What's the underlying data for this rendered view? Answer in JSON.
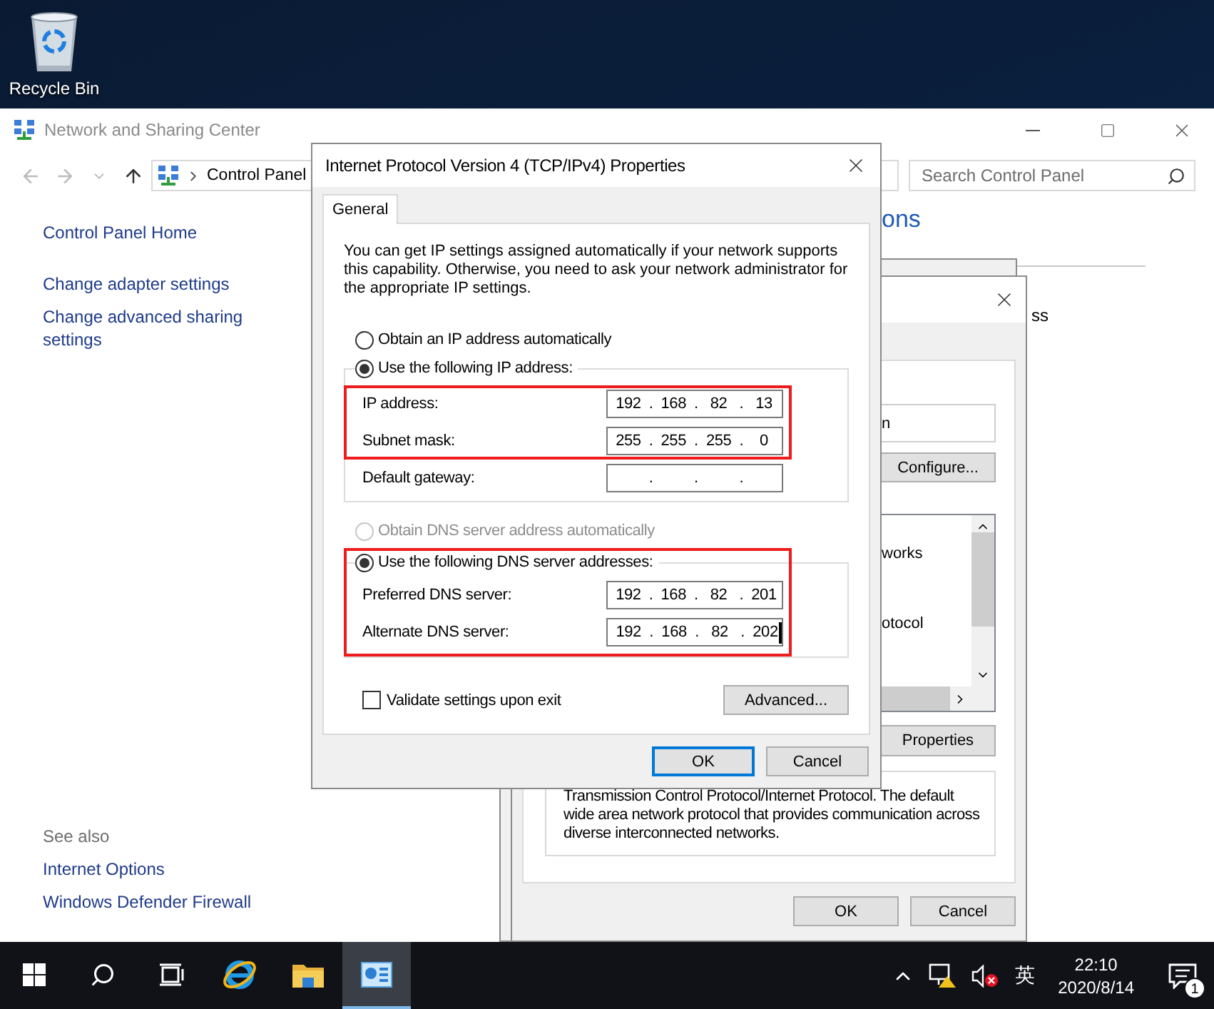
{
  "desktop": {
    "icons": [
      {
        "label": "Recycle Bin"
      }
    ]
  },
  "explorer": {
    "title": "Network and Sharing Center",
    "active": false,
    "nav": {
      "back": {
        "disabled": true
      },
      "forward": {
        "disabled": true
      },
      "up": {
        "disabled": false
      }
    },
    "address": "Control Panel",
    "search": {
      "placeholder": "Search Control Panel"
    },
    "sidebar": {
      "links": [
        "Control Panel Home",
        "Change adapter settings",
        "Change advanced sharing settings"
      ],
      "see_also": {
        "heading": "See also",
        "links": [
          "Internet Options",
          "Windows Defender Firewall"
        ]
      }
    },
    "main": {
      "heading": "ons",
      "fragment": "ss"
    }
  },
  "adapter_dialog": {
    "field_text": "n",
    "configure": "Configure...",
    "list_items": [
      "works",
      "otocol"
    ],
    "properties": "Properties",
    "description": "Transmission Control Protocol/Internet Protocol. The default wide area network protocol that provides communication across diverse interconnected networks.",
    "buttons": [
      {
        "label": "OK",
        "default": false
      },
      {
        "label": "Cancel",
        "default": false
      }
    ]
  },
  "ipv4_dialog": {
    "title": "Internet Protocol Version 4 (TCP/IPv4) Properties",
    "tabs": [
      {
        "label": "General",
        "selected": true
      }
    ],
    "intro": "You can get IP settings assigned automatically if your network supports this capability. Otherwise, you need to ask your network administrator for the appropriate IP settings.",
    "ip_auto": {
      "label": "Obtain an IP address automatically",
      "selected": false,
      "disabled": false
    },
    "ip_group": {
      "label": "Use the following IP address:",
      "selected": true,
      "highlighted": false,
      "rows": [
        {
          "label": "IP address:",
          "octets": [
            "192",
            "168",
            "82",
            "13"
          ],
          "dots": [
            ".",
            ".",
            "."
          ],
          "highlighted": true,
          "focused": false
        },
        {
          "label": "Subnet mask:",
          "octets": [
            "255",
            "255",
            "255",
            "0"
          ],
          "dots": [
            ".",
            ".",
            "."
          ],
          "highlighted": true,
          "focused": false
        },
        {
          "label": "Default gateway:",
          "dots": [
            ".",
            ".",
            "."
          ],
          "highlighted": false,
          "focused": false
        }
      ]
    },
    "dns_auto": {
      "label": "Obtain DNS server address automatically",
      "selected": false,
      "disabled": true
    },
    "dns_group": {
      "label": "Use the following DNS server addresses:",
      "selected": true,
      "highlighted": true,
      "rows": [
        {
          "label": "Preferred DNS server:",
          "octets": [
            "192",
            "168",
            "82",
            "201"
          ],
          "dots": [
            ".",
            ".",
            "."
          ],
          "highlighted": false,
          "focused": false
        },
        {
          "label": "Alternate DNS server:",
          "octets": [
            "192",
            "168",
            "82",
            "202"
          ],
          "dots": [
            ".",
            ".",
            "."
          ],
          "highlighted": false,
          "focused": true
        }
      ]
    },
    "validate": {
      "label": "Validate settings upon exit",
      "checked": false
    },
    "advanced": "Advanced...",
    "buttons": [
      {
        "label": "OK",
        "default": true
      },
      {
        "label": "Cancel",
        "default": false
      }
    ]
  },
  "taskbar": {
    "apps": [
      {
        "kind": "start",
        "selected": false
      },
      {
        "kind": "search",
        "selected": false
      },
      {
        "kind": "task_view",
        "selected": false
      },
      {
        "kind": "browser",
        "selected": false
      },
      {
        "kind": "folder",
        "selected": false
      },
      {
        "kind": "control_panel",
        "selected": true
      }
    ],
    "input_method": "英",
    "time": "22:10",
    "date": "2020/8/14",
    "notifications": "1"
  }
}
